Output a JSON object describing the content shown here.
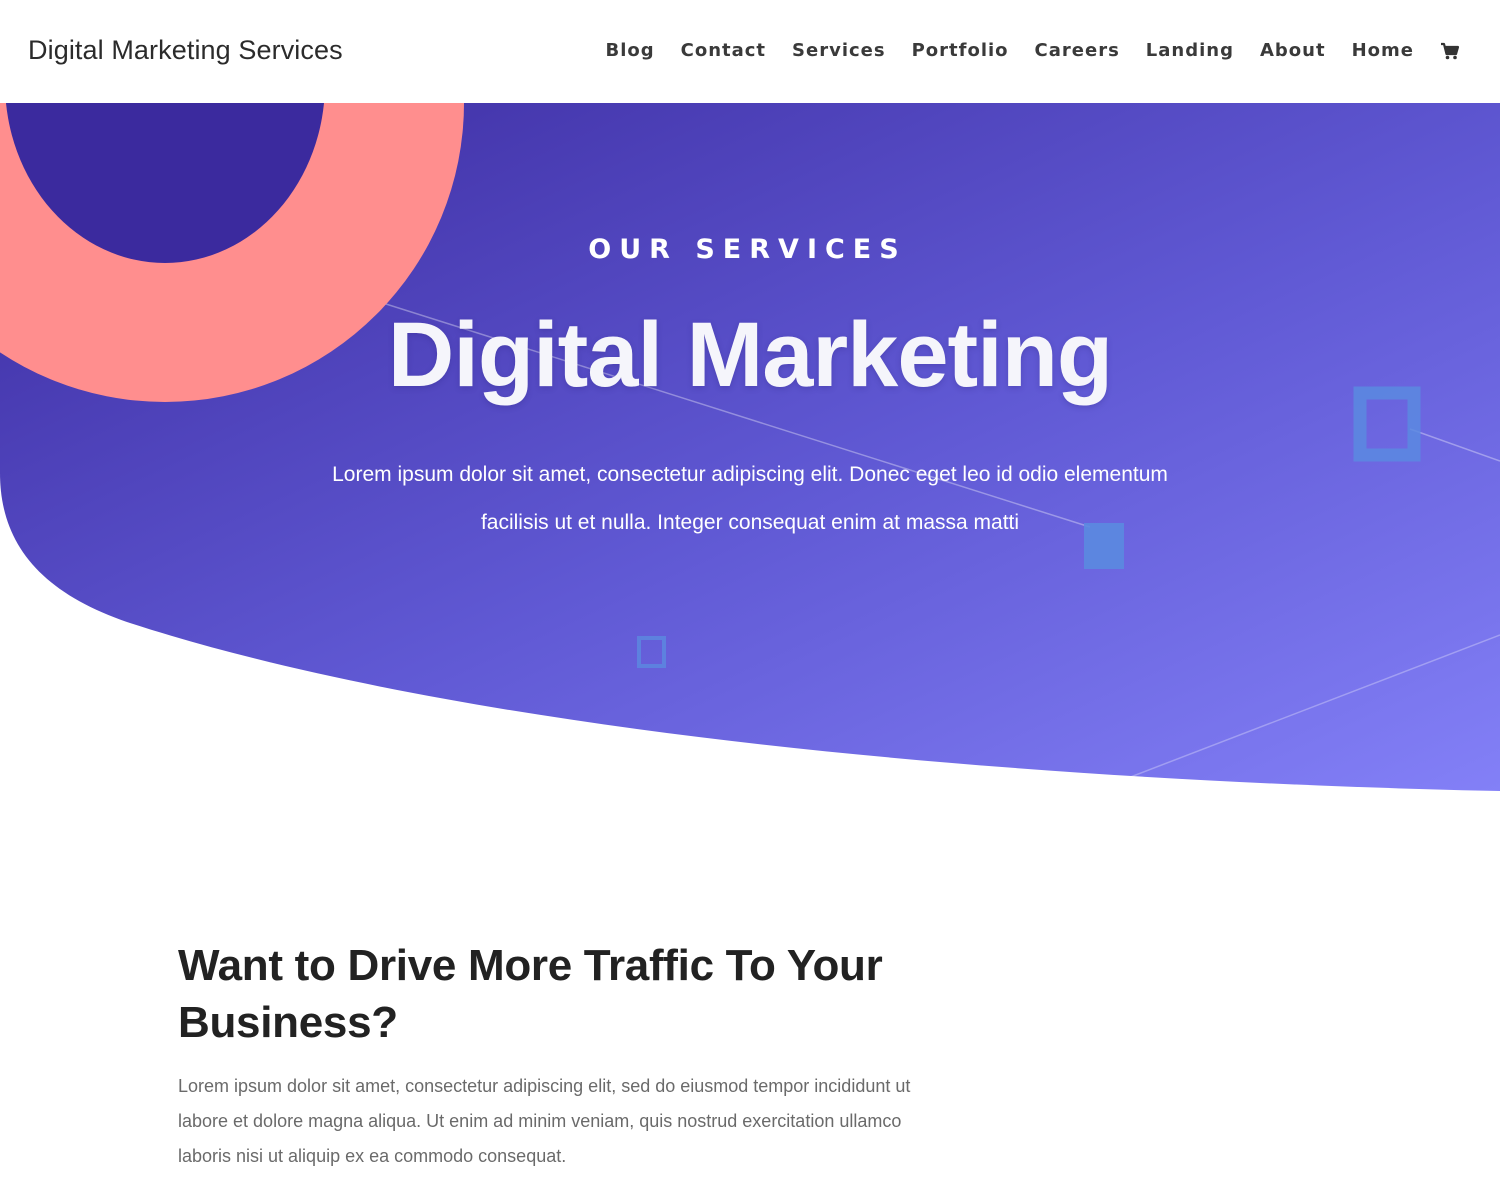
{
  "header": {
    "site_title": "Digital Marketing Services",
    "nav": [
      {
        "label": "Blog"
      },
      {
        "label": "Contact"
      },
      {
        "label": "Services"
      },
      {
        "label": "Portfolio"
      },
      {
        "label": "Careers"
      },
      {
        "label": "Landing"
      },
      {
        "label": "About"
      },
      {
        "label": "Home"
      }
    ],
    "cart_icon": "shopping-cart-icon"
  },
  "hero": {
    "eyebrow": "OUR SERVICES",
    "title": "Digital Marketing",
    "text": "Lorem ipsum dolor sit amet, consectetur adipiscing elit. Donec eget leo id odio elementum facilisis ut et nulla. Integer consequat enim at massa matti"
  },
  "section": {
    "heading": "Want to Drive More Traffic To Your Business?",
    "text": "Lorem ipsum dolor sit amet, consectetur adipiscing elit, sed do eiusmod tempor incididunt ut labore et dolore magna aliqua. Ut enim ad minim veniam, quis nostrud exercitation ullamco laboris nisi ut aliquip ex ea commodo consequat."
  },
  "colors": {
    "hero_gradient_start": "#3b2a9e",
    "hero_gradient_end": "#8380f7",
    "coral_ring": "#ff8e8e",
    "accent_square": "#5b8ae0",
    "heading": "#222222",
    "body_text": "#6a6a6a"
  }
}
